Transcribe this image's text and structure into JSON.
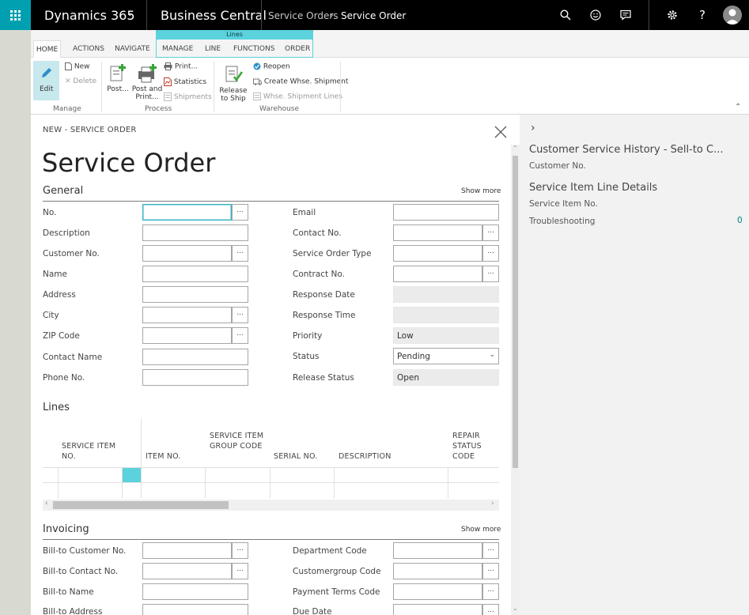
{
  "topbar": {
    "product": "Dynamics 365",
    "app": "Business Central",
    "breadcrumb": [
      "Service Orders",
      "Service Order"
    ]
  },
  "ribbon": {
    "context_tab_group": "Lines",
    "tabs": [
      "HOME",
      "ACTIONS",
      "NAVIGATE",
      "MANAGE",
      "LINE",
      "FUNCTIONS",
      "ORDER"
    ],
    "manage": {
      "label": "Manage",
      "edit": "Edit",
      "new": "New",
      "delete": "Delete"
    },
    "process": {
      "label": "Process",
      "post": "Post...",
      "post_and_print": "Post and Print...",
      "print": "Print...",
      "statistics": "Statistics",
      "shipments": "Shipments"
    },
    "warehouse": {
      "label": "Warehouse",
      "release_to_ship": "Release to Ship",
      "reopen": "Reopen",
      "create_whse_shipment": "Create Whse. Shipment",
      "whse_shipment_lines": "Whse. Shipment Lines"
    }
  },
  "card": {
    "caption": "NEW - SERVICE ORDER",
    "title": "Service Order",
    "general": {
      "title": "General",
      "show_more": "Show more",
      "left_fields": [
        "No.",
        "Description",
        "Customer No.",
        "Name",
        "Address",
        "City",
        "ZIP Code",
        "Contact Name",
        "Phone No."
      ],
      "right_fields": [
        "Email",
        "Contact No.",
        "Service Order Type",
        "Contract No.",
        "Response Date",
        "Response Time",
        "Priority",
        "Status",
        "Release Status"
      ],
      "priority_value": "Low",
      "status_value": "Pending",
      "release_status_value": "Open"
    },
    "lines": {
      "title": "Lines",
      "columns": [
        "SERVICE ITEM NO.",
        "ITEM NO.",
        "SERVICE ITEM GROUP CODE",
        "SERIAL NO.",
        "DESCRIPTION",
        "REPAIR STATUS CODE"
      ]
    },
    "invoicing": {
      "title": "Invoicing",
      "show_more": "Show more",
      "left_fields": [
        "Bill-to Customer No.",
        "Bill-to Contact No.",
        "Bill-to Name",
        "Bill-to Address"
      ],
      "right_fields": [
        "Department Code",
        "Customergroup Code",
        "Payment Terms Code",
        "Due Date"
      ]
    }
  },
  "factbox": {
    "customer_history_title": "Customer Service History - Sell-to C...",
    "customer_no_label": "Customer No.",
    "service_item_title": "Service Item Line Details",
    "service_item_no_label": "Service Item No.",
    "troubleshooting_label": "Troubleshooting",
    "troubleshooting_count": "0"
  },
  "colors": {
    "accent": "#00a0b0",
    "context_tab": "#5bd2dc",
    "link": "#00838f"
  }
}
